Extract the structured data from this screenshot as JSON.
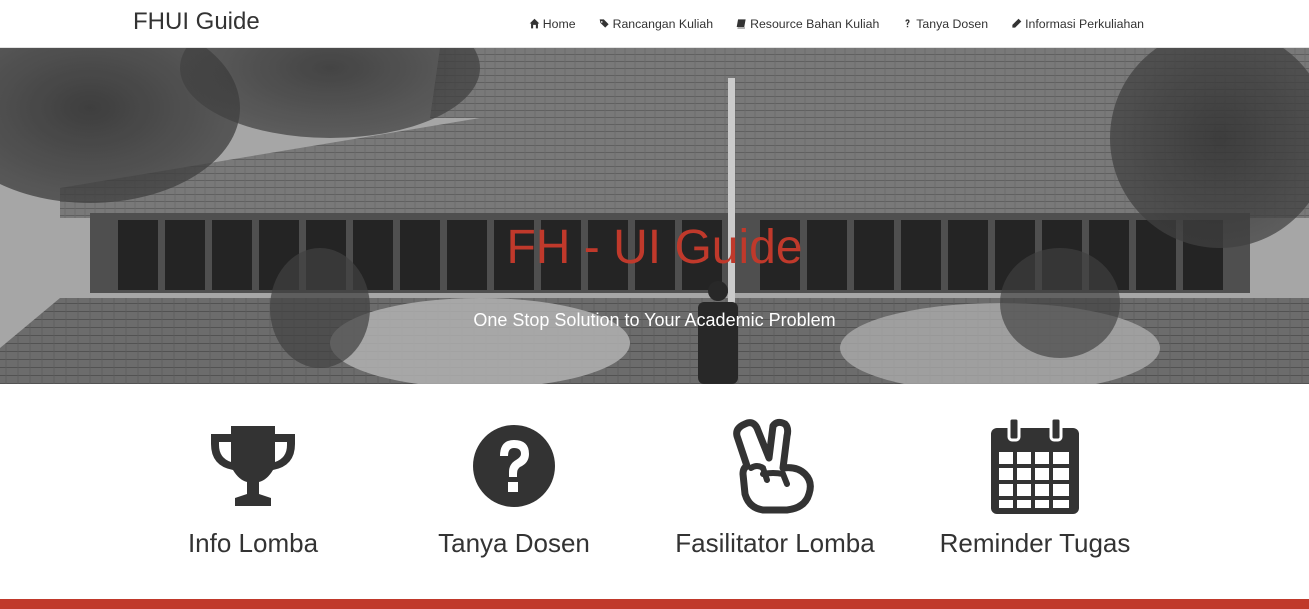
{
  "navbar": {
    "brand": "FHUI Guide",
    "items": [
      {
        "label": "Home",
        "icon": "home-icon"
      },
      {
        "label": "Rancangan Kuliah",
        "icon": "tags-icon"
      },
      {
        "label": "Resource Bahan Kuliah",
        "icon": "book-icon"
      },
      {
        "label": "Tanya Dosen",
        "icon": "question-icon"
      },
      {
        "label": "Informasi Perkuliahan",
        "icon": "pencil-icon"
      }
    ]
  },
  "hero": {
    "title": "FH - UI Guide",
    "subtitle": "One Stop Solution to Your Academic Problem",
    "title_color": "#c0392b"
  },
  "features": [
    {
      "label": "Info Lomba",
      "icon": "trophy-icon"
    },
    {
      "label": "Tanya Dosen",
      "icon": "question-circle-icon"
    },
    {
      "label": "Fasilitator Lomba",
      "icon": "peace-hand-icon"
    },
    {
      "label": "Reminder Tugas",
      "icon": "calendar-icon"
    }
  ],
  "colors": {
    "accent": "#c0392b",
    "icon": "#333333"
  }
}
